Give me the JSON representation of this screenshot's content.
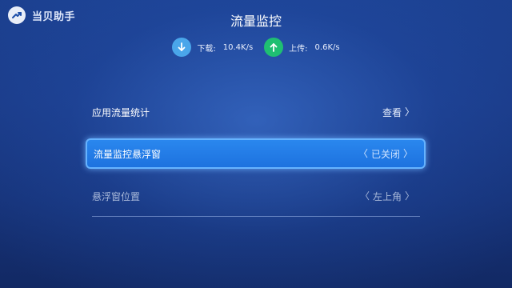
{
  "brand": {
    "name": "当贝助手",
    "icon": "dangbei-logo-icon"
  },
  "page": {
    "title": "流量监控"
  },
  "speeds": {
    "download": {
      "label": "下载:",
      "value": "10.4K/s",
      "icon": "download-arrow-icon",
      "color": "#4aa6ea"
    },
    "upload": {
      "label": "上传:",
      "value": "0.6K/s",
      "icon": "upload-arrow-icon",
      "color": "#1fbf72"
    }
  },
  "menu": {
    "app_stats": {
      "label": "应用流量统计",
      "value": "查看"
    },
    "float_window": {
      "label": "流量监控悬浮窗",
      "value": "已关闭"
    },
    "float_position": {
      "label": "悬浮窗位置",
      "value": "左上角"
    }
  },
  "colors": {
    "background": "#1a3a86",
    "highlight": "#2a87ee",
    "highlight_border": "#66b3ff"
  }
}
